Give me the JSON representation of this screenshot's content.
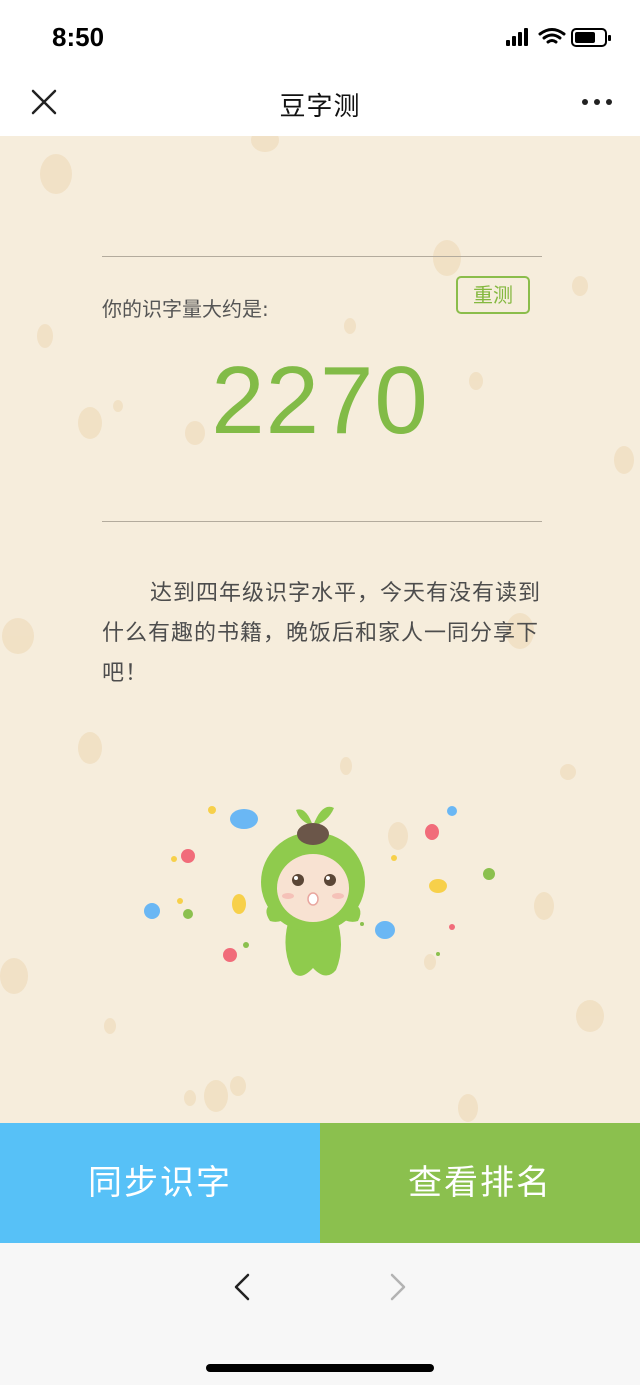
{
  "status_bar": {
    "time": "8:50",
    "icons": [
      "signal-icon",
      "wifi-icon",
      "battery-icon"
    ]
  },
  "nav": {
    "title": "豆字测",
    "close_icon": "close-icon",
    "more_icon": "more-icon"
  },
  "result": {
    "label": "你的识字量大约是:",
    "retest_label": "重测",
    "score": "2270",
    "description": "达到四年级识字水平，今天有没有读到什么有趣的书籍，晚饭后和家人一同分享下吧！"
  },
  "actions": {
    "sync_label": "同步识字",
    "rank_label": "查看排名"
  },
  "browser": {
    "back_icon": "chevron-left-icon",
    "forward_icon": "chevron-right-icon"
  },
  "colors": {
    "background": "#f6eddc",
    "accent_green": "#82bb47",
    "sync_blue": "#57c1f7",
    "rank_green": "#8bc04e"
  }
}
